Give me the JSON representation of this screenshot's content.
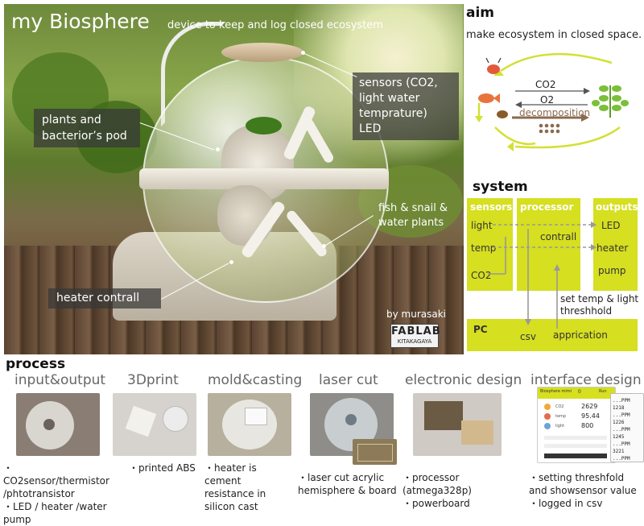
{
  "header": {
    "title": "my Biosphere",
    "subtitle": "device to keep and log closed ecosystem"
  },
  "photo_labels": {
    "sensors": "sensors (CO2, light water temprature)",
    "led": "LED",
    "pod": "plants  and bacterior’s pod",
    "fish": "fish & snail & water plants",
    "heater": "heater contrall",
    "credit": "by murasaki",
    "fablab": "FABLAB",
    "fablab_sub": "KITAKAGAYA"
  },
  "aim": {
    "heading": "aim",
    "text": "make ecosystem in closed space.",
    "co2": "CO2",
    "o2": "O2",
    "decomposition": "decomposition"
  },
  "system": {
    "heading": "system",
    "sensors_head": "sensors",
    "sensors": [
      "light",
      "temp",
      "CO2"
    ],
    "processor_head": "processor",
    "processor_text": "contrall",
    "outputs_head": "outputs",
    "outputs": [
      "LED",
      "heater",
      "pump"
    ],
    "pc_head": "PC",
    "csv": "csv",
    "application": "apprication",
    "set_label": "set temp & light threshhold"
  },
  "process": {
    "heading": "process",
    "steps": [
      {
        "title": "input&output",
        "caption": "・CO2sensor/thermistor /phtotransistor\n・LED / heater /water pump"
      },
      {
        "title": "3Dprint",
        "caption": "・printed ABS"
      },
      {
        "title": "mold&casting",
        "caption": "・heater is cement resistance in silicon cast"
      },
      {
        "title": "laser cut",
        "caption": "・laser cut acrylic hemisphere & board"
      },
      {
        "title": "electronic design",
        "caption": "・processor (atmega328p)\n・powerboard"
      },
      {
        "title": "interface design",
        "caption": "・setting threshfold and showsensor value\n・logged in csv"
      }
    ]
  },
  "interface_screen": {
    "app_title": "Biosphere mimi",
    "value_a": "0",
    "value_b": "Run",
    "readings": [
      {
        "label": "CO2",
        "value": "2629"
      },
      {
        "label": "temp",
        "value": "95.44"
      },
      {
        "label": "light",
        "value": "800"
      }
    ],
    "log_lines": [
      "...PPM 1218",
      "...PPM 1226",
      "...PPM 1245",
      "...PPM 3221",
      "...PPM 1233"
    ]
  },
  "colors": {
    "accent_lime": "#d6df20",
    "arrow_lime": "#d3e034",
    "arrow_brown": "#8b6a4f",
    "tag_bg": "#373737"
  }
}
